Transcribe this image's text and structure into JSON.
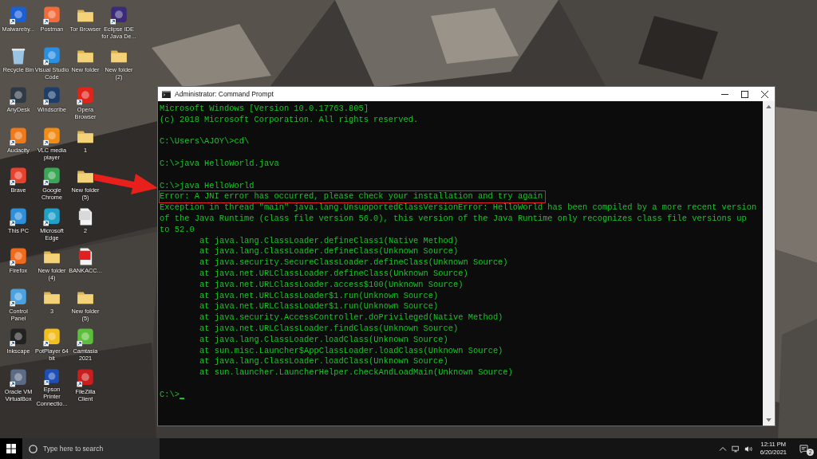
{
  "desktop_icons": [
    {
      "label": "Malwareby...",
      "kind": "app",
      "color": "#1b5fd6"
    },
    {
      "label": "Recycle Bin",
      "kind": "bin",
      "color": "#9bc4e2"
    },
    {
      "label": "AnyDesk",
      "kind": "app",
      "color": "#2f3a46"
    },
    {
      "label": "Audacity",
      "kind": "app",
      "color": "#f07a1a"
    },
    {
      "label": "Brave",
      "kind": "app",
      "color": "#e8412c"
    },
    {
      "label": "This PC",
      "kind": "app",
      "color": "#2f8fd8"
    },
    {
      "label": "Firefox",
      "kind": "app",
      "color": "#f06a1d"
    },
    {
      "label": "Control Panel",
      "kind": "app",
      "color": "#4aa3e0"
    },
    {
      "label": "Inkscape",
      "kind": "app",
      "color": "#222222"
    },
    {
      "label": "Oracle VM VirtualBox",
      "kind": "app",
      "color": "#5c6b86"
    },
    {
      "label": "Postman",
      "kind": "app",
      "color": "#f26b3a"
    },
    {
      "label": "Visual Studio Code",
      "kind": "app",
      "color": "#2a8fe0"
    },
    {
      "label": "Windscribe",
      "kind": "app",
      "color": "#1d3d6b"
    },
    {
      "label": "VLC media player",
      "kind": "app",
      "color": "#f28c13"
    },
    {
      "label": "Google Chrome",
      "kind": "app",
      "color": "#3aa757"
    },
    {
      "label": "Microsoft Edge",
      "kind": "app",
      "color": "#1fa0c8"
    },
    {
      "label": "New folder (4)",
      "kind": "folder",
      "color": "#f3d27a"
    },
    {
      "label": "3",
      "kind": "folder",
      "color": "#f3d27a"
    },
    {
      "label": "PotPlayer 64 bit",
      "kind": "app",
      "color": "#f2c01e"
    },
    {
      "label": "Epson Printer Connectio...",
      "kind": "app",
      "color": "#1e4fb8"
    },
    {
      "label": "Tor Browser",
      "kind": "folder",
      "color": "#f3d27a"
    },
    {
      "label": "New folder",
      "kind": "folder",
      "color": "#f3d27a"
    },
    {
      "label": "Opera Browser",
      "kind": "app",
      "color": "#e2231a"
    },
    {
      "label": "1",
      "kind": "folder",
      "color": "#f3d27a"
    },
    {
      "label": "New folder (5)",
      "kind": "folder",
      "color": "#f3d27a"
    },
    {
      "label": "2",
      "kind": "file",
      "color": "#d9d9d9"
    },
    {
      "label": "BANKACC...",
      "kind": "file",
      "color": "#e02020"
    },
    {
      "label": "New folder (5)",
      "kind": "folder",
      "color": "#f3d27a"
    },
    {
      "label": "Camtasia 2021",
      "kind": "app",
      "color": "#5bbf3b"
    },
    {
      "label": "FileZilla Client",
      "kind": "app",
      "color": "#c81e1e"
    },
    {
      "label": "Eclipse IDE for Java De...",
      "kind": "app",
      "color": "#3b2a7a"
    },
    {
      "label": "New folder (2)",
      "kind": "folder",
      "color": "#f3d27a"
    }
  ],
  "console_window": {
    "title": "Administrator: Command Prompt",
    "lines": [
      {
        "text": "Microsoft Windows [Version 10.0.17763.805]",
        "kind": "output",
        "highlighted": false
      },
      {
        "text": "(c) 2018 Microsoft Corporation. All rights reserved.",
        "kind": "output",
        "highlighted": false
      },
      {
        "kind": "blank"
      },
      {
        "text": "C:\\Users\\AJOY\\>cd\\",
        "kind": "output",
        "highlighted": false
      },
      {
        "kind": "blank"
      },
      {
        "text": "C:\\>java HelloWorld.java",
        "kind": "output",
        "highlighted": false
      },
      {
        "kind": "blank"
      },
      {
        "text": "C:\\>java HelloWorld",
        "kind": "output",
        "highlighted": false
      },
      {
        "text": "Error: A JNI error has occurred, please check your installation and try again",
        "kind": "output",
        "highlighted": true
      },
      {
        "text": "Exception in thread \"main\" java.lang.UnsupportedClassVersionError: HelloWorld has been compiled by a more recent version",
        "kind": "output",
        "highlighted": false
      },
      {
        "text": "of the Java Runtime (class file version 56.0), this version of the Java Runtime only recognizes class file versions up",
        "kind": "output",
        "highlighted": false
      },
      {
        "text": "to 52.0",
        "kind": "output",
        "highlighted": false
      },
      {
        "text": "at java.lang.ClassLoader.defineClass1(Native Method)",
        "kind": "stack",
        "highlighted": false
      },
      {
        "text": "at java.lang.ClassLoader.defineClass(Unknown Source)",
        "kind": "stack",
        "highlighted": false
      },
      {
        "text": "at java.security.SecureClassLoader.defineClass(Unknown Source)",
        "kind": "stack",
        "highlighted": false
      },
      {
        "text": "at java.net.URLClassLoader.defineClass(Unknown Source)",
        "kind": "stack",
        "highlighted": false
      },
      {
        "text": "at java.net.URLClassLoader.access$100(Unknown Source)",
        "kind": "stack",
        "highlighted": false
      },
      {
        "text": "at java.net.URLClassLoader$1.run(Unknown Source)",
        "kind": "stack",
        "highlighted": false
      },
      {
        "text": "at java.net.URLClassLoader$1.run(Unknown Source)",
        "kind": "stack",
        "highlighted": false
      },
      {
        "text": "at java.security.AccessController.doPrivileged(Native Method)",
        "kind": "stack",
        "highlighted": false
      },
      {
        "text": "at java.net.URLClassLoader.findClass(Unknown Source)",
        "kind": "stack",
        "highlighted": false
      },
      {
        "text": "at java.lang.ClassLoader.loadClass(Unknown Source)",
        "kind": "stack",
        "highlighted": false
      },
      {
        "text": "at sun.misc.Launcher$AppClassLoader.loadClass(Unknown Source)",
        "kind": "stack",
        "highlighted": false
      },
      {
        "text": "at java.lang.ClassLoader.loadClass(Unknown Source)",
        "kind": "stack",
        "highlighted": false
      },
      {
        "text": "at sun.launcher.LauncherHelper.checkAndLoadMain(Unknown Source)",
        "kind": "stack",
        "highlighted": false
      },
      {
        "kind": "blank"
      },
      {
        "text": "C:\\>",
        "kind": "prompt",
        "highlighted": false,
        "cursor": true
      }
    ]
  },
  "annotation_arrow": {
    "kind": "arrow"
  },
  "taskbar": {
    "search": {
      "placeholder": "Type here to search"
    },
    "time": "12:11 PM",
    "date": "6/20/2021",
    "notifications": "2"
  }
}
